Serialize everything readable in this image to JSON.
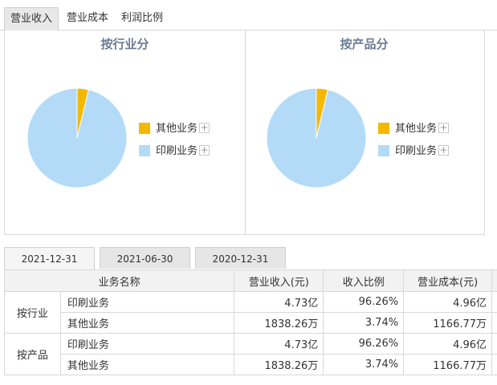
{
  "top_tabs": [
    {
      "label": "营业收入",
      "active": true
    },
    {
      "label": "营业成本",
      "active": false
    },
    {
      "label": "利润比例",
      "active": false
    }
  ],
  "charts": [
    {
      "title": "按行业分",
      "legend": [
        {
          "label": "其他业务",
          "color": "#f4b800"
        },
        {
          "label": "印刷业务",
          "color": "#b3dbf7"
        }
      ]
    },
    {
      "title": "按产品分",
      "legend": [
        {
          "label": "其他业务",
          "color": "#f4b800"
        },
        {
          "label": "印刷业务",
          "color": "#b3dbf7"
        }
      ]
    }
  ],
  "chart_data": [
    {
      "type": "pie",
      "title": "按行业分",
      "categories": [
        "其他业务",
        "印刷业务"
      ],
      "values": [
        3.74,
        96.26
      ],
      "colors": [
        "#f4b800",
        "#b3dbf7"
      ],
      "legend_position": "right"
    },
    {
      "type": "pie",
      "title": "按产品分",
      "categories": [
        "其他业务",
        "印刷业务"
      ],
      "values": [
        3.74,
        96.26
      ],
      "colors": [
        "#f4b800",
        "#b3dbf7"
      ],
      "legend_position": "right"
    }
  ],
  "date_tabs": [
    {
      "label": "2021-12-31",
      "active": true
    },
    {
      "label": "2021-06-30",
      "active": false
    },
    {
      "label": "2020-12-31",
      "active": false
    }
  ],
  "table": {
    "headers": [
      "业务名称",
      "营业收入(元)",
      "收入比例",
      "营业成本(元)"
    ],
    "groups": [
      {
        "label": "按行业",
        "rows": [
          {
            "name": "印刷业务",
            "revenue": "4.73亿",
            "ratio": "96.26%",
            "cost": "4.96亿"
          },
          {
            "name": "其他业务",
            "revenue": "1838.26万",
            "ratio": "3.74%",
            "cost": "1166.77万"
          }
        ]
      },
      {
        "label": "按产品",
        "rows": [
          {
            "name": "印刷业务",
            "revenue": "4.73亿",
            "ratio": "96.26%",
            "cost": "4.96亿"
          },
          {
            "name": "其他业务",
            "revenue": "1838.26万",
            "ratio": "3.74%",
            "cost": "1166.77万"
          }
        ]
      }
    ]
  }
}
